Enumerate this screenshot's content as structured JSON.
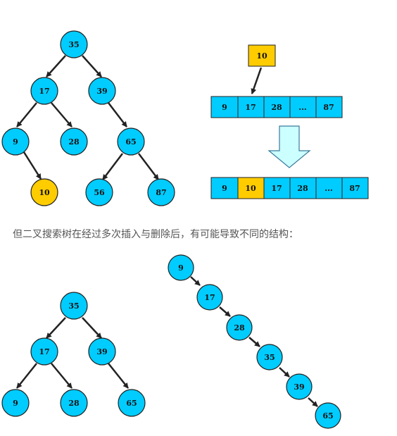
{
  "colors": {
    "node_fill": "#00ccff",
    "highlight_fill": "#ffcc00",
    "stroke": "#222222",
    "arrow_fill": "#ccffff"
  },
  "top_tree": {
    "nodes": [
      "35",
      "17",
      "39",
      "9",
      "28",
      "65",
      "10",
      "56",
      "87"
    ],
    "highlighted": "10"
  },
  "insert_value": "10",
  "array_before": [
    "9",
    "17",
    "28",
    "...",
    "87"
  ],
  "array_after": [
    "9",
    "10",
    "17",
    "28",
    "...",
    "87"
  ],
  "array_after_highlighted_index": 1,
  "caption": "但二叉搜索树在经过多次插入与删除后，有可能导致不同的结构：",
  "balanced_tree": {
    "nodes": [
      "35",
      "17",
      "39",
      "9",
      "28",
      "65"
    ]
  },
  "chain_tree": {
    "nodes": [
      "9",
      "17",
      "28",
      "35",
      "39",
      "65"
    ]
  }
}
